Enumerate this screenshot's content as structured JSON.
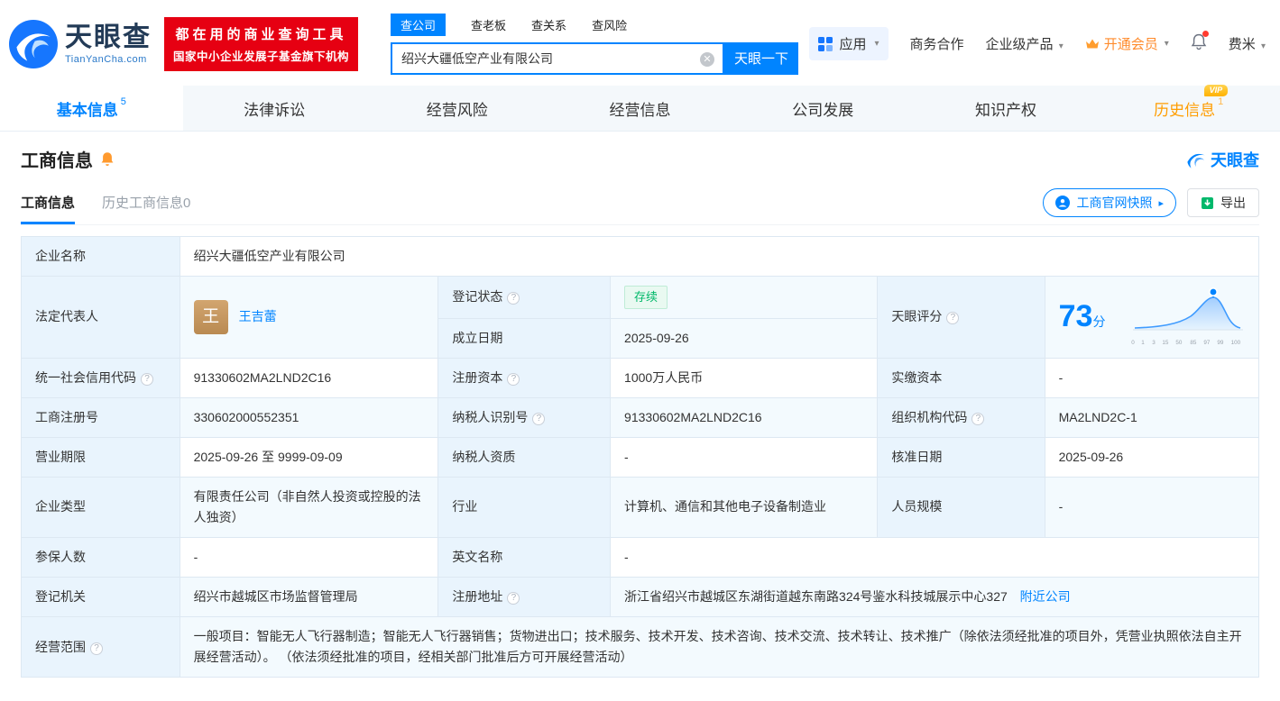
{
  "colors": {
    "primary": "#0084ff",
    "banner_red": "#e60012",
    "vip_orange": "#ff9d00",
    "status_green": "#00b869"
  },
  "brand": {
    "name": "天眼查",
    "domain": "TianYanCha.com"
  },
  "banner": {
    "line1": "都在用的商业查询工具",
    "line2": "国家中小企业发展子基金旗下机构"
  },
  "search": {
    "tabs": [
      {
        "label": "查公司"
      },
      {
        "label": "查老板"
      },
      {
        "label": "查关系"
      },
      {
        "label": "查风险"
      }
    ],
    "value": "绍兴大疆低空产业有限公司",
    "button": "天眼一下"
  },
  "topnav": {
    "app": "应用",
    "cooperation": "商务合作",
    "enterprise": "企业级产品",
    "vip": "开通会员",
    "user": "费米"
  },
  "tabs": [
    {
      "label": "基本信息",
      "badge": "5"
    },
    {
      "label": "法律诉讼"
    },
    {
      "label": "经营风险"
    },
    {
      "label": "经营信息"
    },
    {
      "label": "公司发展"
    },
    {
      "label": "知识产权"
    },
    {
      "label": "历史信息",
      "badge": "1",
      "tag": "VIP"
    }
  ],
  "section": {
    "title": "工商信息",
    "brand": "天眼查",
    "subtabs": [
      {
        "label": "工商信息"
      },
      {
        "label": "历史工商信息0"
      }
    ],
    "snapshot": "工商官网快照",
    "export": "导出"
  },
  "fields": {
    "name": {
      "label": "企业名称",
      "value": "绍兴大疆低空产业有限公司"
    },
    "legal_rep": {
      "label": "法定代表人",
      "value": "王吉蕾",
      "avatar": "王"
    },
    "reg_status": {
      "label": "登记状态",
      "value": "存续"
    },
    "establish_date": {
      "label": "成立日期",
      "value": "2025-09-26"
    },
    "score": {
      "label": "天眼评分",
      "value": "73",
      "unit": "分",
      "axis": [
        "0",
        "1",
        "3",
        "15",
        "50",
        "85",
        "97",
        "99",
        "100"
      ]
    },
    "credit_code": {
      "label": "统一社会信用代码",
      "value": "91330602MA2LND2C16"
    },
    "reg_capital": {
      "label": "注册资本",
      "value": "1000万人民币"
    },
    "paid_capital": {
      "label": "实缴资本",
      "value": "-"
    },
    "reg_number": {
      "label": "工商注册号",
      "value": "330602000552351"
    },
    "taxpayer_id": {
      "label": "纳税人识别号",
      "value": "91330602MA2LND2C16"
    },
    "org_code": {
      "label": "组织机构代码",
      "value": "MA2LND2C-1"
    },
    "business_term": {
      "label": "营业期限",
      "value": "2025-09-26 至 9999-09-09"
    },
    "taxpayer_qualification": {
      "label": "纳税人资质",
      "value": "-"
    },
    "approval_date": {
      "label": "核准日期",
      "value": "2025-09-26"
    },
    "company_type": {
      "label": "企业类型",
      "value": "有限责任公司（非自然人投资或控股的法人独资）"
    },
    "industry": {
      "label": "行业",
      "value": "计算机、通信和其他电子设备制造业"
    },
    "staff_size": {
      "label": "人员规模",
      "value": "-"
    },
    "insured_count": {
      "label": "参保人数",
      "value": "-"
    },
    "english_name": {
      "label": "英文名称",
      "value": "-"
    },
    "reg_authority": {
      "label": "登记机关",
      "value": "绍兴市越城区市场监督管理局"
    },
    "reg_address": {
      "label": "注册地址",
      "value": "浙江省绍兴市越城区东湖街道越东南路324号鉴水科技城展示中心327",
      "link": "附近公司"
    },
    "business_scope": {
      "label": "经营范围",
      "value": "一般项目：智能无人飞行器制造；智能无人飞行器销售；货物进出口；技术服务、技术开发、技术咨询、技术交流、技术转让、技术推广（除依法须经批准的项目外，凭营业执照依法自主开展经营活动）。 （依法须经批准的项目，经相关部门批准后方可开展经营活动）"
    }
  }
}
